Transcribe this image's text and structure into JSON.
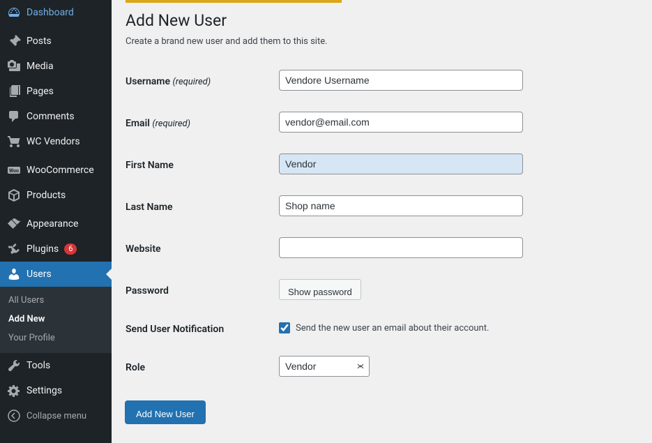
{
  "sidebar": {
    "items": [
      {
        "label": "Dashboard"
      },
      {
        "label": "Posts"
      },
      {
        "label": "Media"
      },
      {
        "label": "Pages"
      },
      {
        "label": "Comments"
      },
      {
        "label": "WC Vendors"
      },
      {
        "label": "WooCommerce"
      },
      {
        "label": "Products"
      },
      {
        "label": "Appearance"
      },
      {
        "label": "Plugins",
        "badge": "6"
      },
      {
        "label": "Users"
      },
      {
        "label": "Tools"
      },
      {
        "label": "Settings"
      }
    ],
    "submenu": {
      "all_users": "All Users",
      "add_new": "Add New",
      "your_profile": "Your Profile"
    },
    "collapse": "Collapse menu"
  },
  "page": {
    "title": "Add New User",
    "subtitle": "Create a brand new user and add them to this site."
  },
  "form": {
    "username_label": "Username ",
    "username_required": "(required)",
    "username_value": "Vendore Username",
    "email_label": "Email ",
    "email_required": "(required)",
    "email_value": "vendor@email.com",
    "firstname_label": "First Name",
    "firstname_value": "Vendor",
    "lastname_label": "Last Name",
    "lastname_value": "Shop name",
    "website_label": "Website",
    "website_value": "",
    "password_label": "Password",
    "password_button": "Show password",
    "notification_label": "Send User Notification",
    "notification_text": "Send the new user an email about their account.",
    "role_label": "Role",
    "role_value": "Vendor",
    "submit": "Add New User"
  }
}
